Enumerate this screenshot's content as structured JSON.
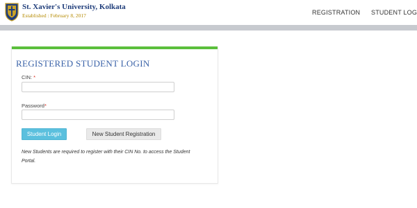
{
  "header": {
    "brand_name": "St. Xavier's University, Kolkata",
    "established": "Established : February 8, 2017",
    "nav": [
      {
        "label": "REGISTRATION"
      },
      {
        "label": "STUDENT LOGIN"
      }
    ]
  },
  "login_card": {
    "title": "REGISTERED STUDENT LOGIN",
    "accent_color": "#5bbf3c",
    "cin": {
      "label": "CIN:",
      "required_marker": "*",
      "value": ""
    },
    "password": {
      "label": "Password",
      "required_marker": "*",
      "value": ""
    },
    "login_button": "Student Login",
    "register_button": "New Student Registration",
    "note_line1": "New Students are required to register with their CIN No. to access the Student",
    "note_line2": "Portal."
  },
  "colors": {
    "primary_button": "#5bc0de",
    "title": "#3b63a8",
    "required": "#d9291c",
    "brand": "#1f3d7a"
  },
  "icons": {
    "logo": "university-crest-icon"
  }
}
